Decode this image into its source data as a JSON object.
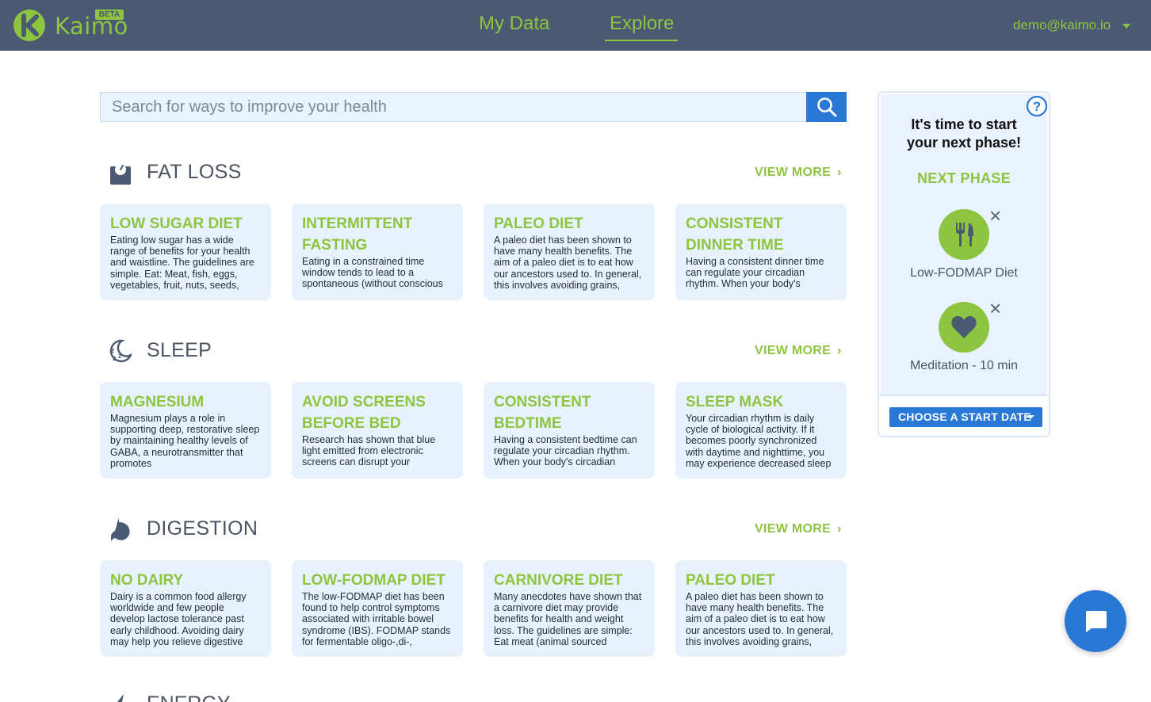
{
  "header": {
    "brand": "Kaimo",
    "beta": "BETA",
    "nav": [
      "My Data",
      "Explore"
    ],
    "active_nav": "Explore",
    "user_email": "demo@kaimo.io"
  },
  "search": {
    "placeholder": "Search for ways to improve your health"
  },
  "view_more_label": "VIEW MORE",
  "sections": [
    {
      "title": "FAT LOSS",
      "icon": "scale-icon",
      "cards": [
        {
          "title": "LOW SUGAR DIET",
          "desc": "Eating low sugar has a wide range of benefits for your health and waistline. The guidelines are simple. Eat: Meat, fish, eggs, vegetables, fruit, nuts, seeds,"
        },
        {
          "title": "INTERMITTENT FASTING",
          "desc": "Eating in a constrained time window tends to lead to a spontaneous (without conscious"
        },
        {
          "title": "PALEO DIET",
          "desc": "A paleo diet has been shown to have many health benefits. The aim of a paleo diet is to eat how our ancestors used to. In general, this involves avoiding grains,"
        },
        {
          "title": "CONSISTENT DINNER TIME",
          "desc": "Having a consistent dinner time can regulate your circadian rhythm. When your body's"
        }
      ]
    },
    {
      "title": "SLEEP",
      "icon": "sleep-icon",
      "cards": [
        {
          "title": "MAGNESIUM",
          "desc": "Magnesium plays a role in supporting deep, restorative sleep by maintaining healthy levels of GABA, a neurotransmitter that promotes"
        },
        {
          "title": "AVOID SCREENS BEFORE BED",
          "desc": "Research has shown that blue light emitted from electronic screens can disrupt your"
        },
        {
          "title": "CONSISTENT BEDTIME",
          "desc": "Having a consistent bedtime can regulate your circadian rhythm. When your body's circadian"
        },
        {
          "title": "SLEEP MASK",
          "desc": "Your circadian rhythm is daily cycle of biological activity. If it becomes poorly synchronized with daytime and nighttime, you may experience decreased sleep"
        }
      ]
    },
    {
      "title": "DIGESTION",
      "icon": "stomach-icon",
      "cards": [
        {
          "title": "NO DAIRY",
          "desc": "Dairy is a common food allergy worldwide and few people develop lactose tolerance past early childhood. Avoiding dairy may help you relieve digestive"
        },
        {
          "title": "LOW-FODMAP DIET",
          "desc": "The low-FODMAP diet has been found to help control symptoms associated with irritable bowel syndrome (IBS). FODMAP stands for fermentable oligo-,di-,"
        },
        {
          "title": "CARNIVORE DIET",
          "desc": "Many anecdotes have shown that a carnivore diet may provide benefits for health and weight loss. The guidelines are simple: Eat meat (animal sourced"
        },
        {
          "title": "PALEO DIET",
          "desc": "A paleo diet has been shown to have many health benefits. The aim of a paleo diet is to eat how our ancestors used to. In general, this involves avoiding grains,"
        }
      ]
    }
  ],
  "next_section_title": "ENERGY",
  "panel": {
    "heading_line1": "It's time to start",
    "heading_line2": "your next phase!",
    "next_phase_label": "NEXT PHASE",
    "items": [
      {
        "label": "Low-FODMAP Diet",
        "icon": "fork-knife-icon"
      },
      {
        "label": "Meditation - 10 min",
        "icon": "heart-icon"
      }
    ],
    "choose_button": "CHOOSE A START DATE"
  },
  "colors": {
    "nav_bg": "#4a5a73",
    "accent_green": "#8dc440",
    "primary_blue": "#2a78d6",
    "card_bg": "#e8f2fd"
  }
}
